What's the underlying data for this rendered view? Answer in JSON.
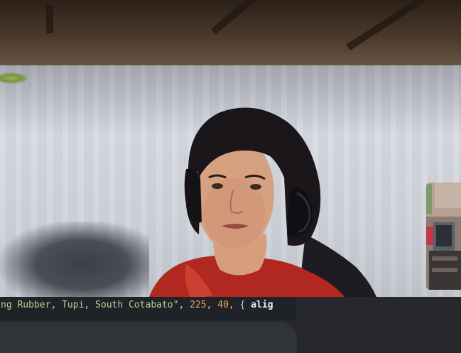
{
  "video_call": {
    "main_tile": {
      "participant": "remote-participant"
    },
    "self_view": {
      "participant": "self"
    }
  },
  "code_line": {
    "string_text": "ng Rubber, Tupi, South Cotabato\"",
    "separator_1": ", ",
    "num_1": "225",
    "separator_2": ", ",
    "num_2": "40",
    "separator_3": ", { ",
    "key_text": "alig"
  },
  "colors": {
    "code_background": "#1f2226",
    "string_color": "#b8d39b",
    "number_color": "#e6a26b",
    "toolbar_background": "#26282c"
  }
}
